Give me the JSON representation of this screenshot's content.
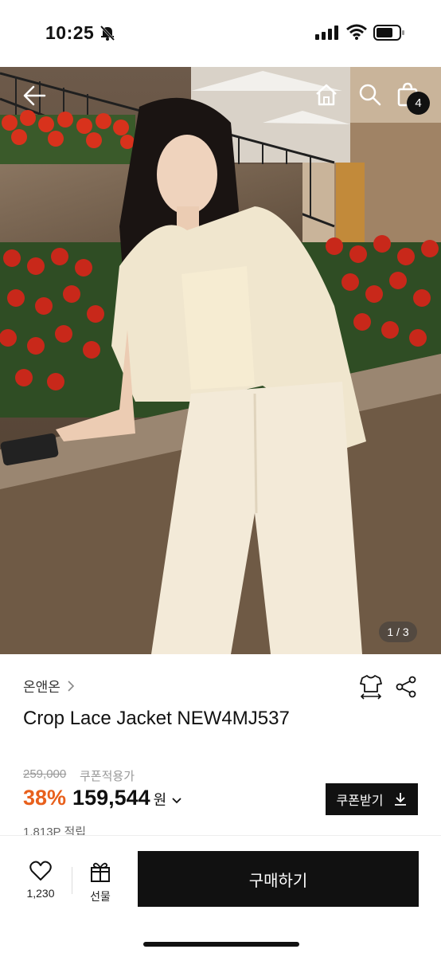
{
  "status_bar": {
    "time": "10:25"
  },
  "header": {
    "cart_count": "4"
  },
  "gallery": {
    "counter": "1 / 3"
  },
  "product": {
    "brand": "온앤온",
    "title": "Crop Lace Jacket NEW4MJ537",
    "original_price": "259,000",
    "coupon_label": "쿠폰적용가",
    "discount": "38%",
    "price": "159,544",
    "currency": "원",
    "coupon_button": "쿠폰받기",
    "points": "1,813P 적립"
  },
  "bottom_bar": {
    "like_count": "1,230",
    "gift_label": "선물",
    "buy_label": "구매하기"
  },
  "colors": {
    "accent": "#e8601c",
    "primary": "#111111"
  }
}
